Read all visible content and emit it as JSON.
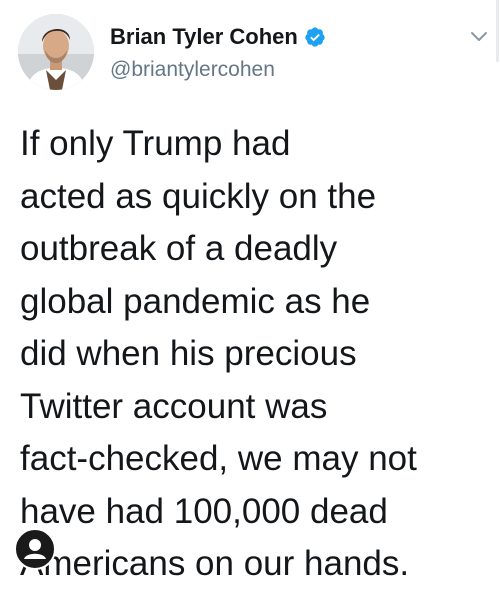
{
  "tweet": {
    "author": {
      "display_name": "Brian Tyler Cohen",
      "handle": "@briantylercohen",
      "verified": true,
      "avatar_icon": "profile-photo"
    },
    "menu_icon": "chevron-down-icon",
    "text_lines": [
      "If only Trump had",
      "acted as quickly on the",
      "outbreak of a deadly",
      "global pandemic as he",
      "did when his precious",
      "Twitter account was",
      "fact-checked, we may not",
      "have had 100,000 dead",
      "Americans on our hands."
    ],
    "overlay_icon": "user-icon"
  },
  "colors": {
    "text": "#14171a",
    "secondary_text": "#657786",
    "verified_blue": "#1da1f2",
    "background": "#ffffff"
  }
}
